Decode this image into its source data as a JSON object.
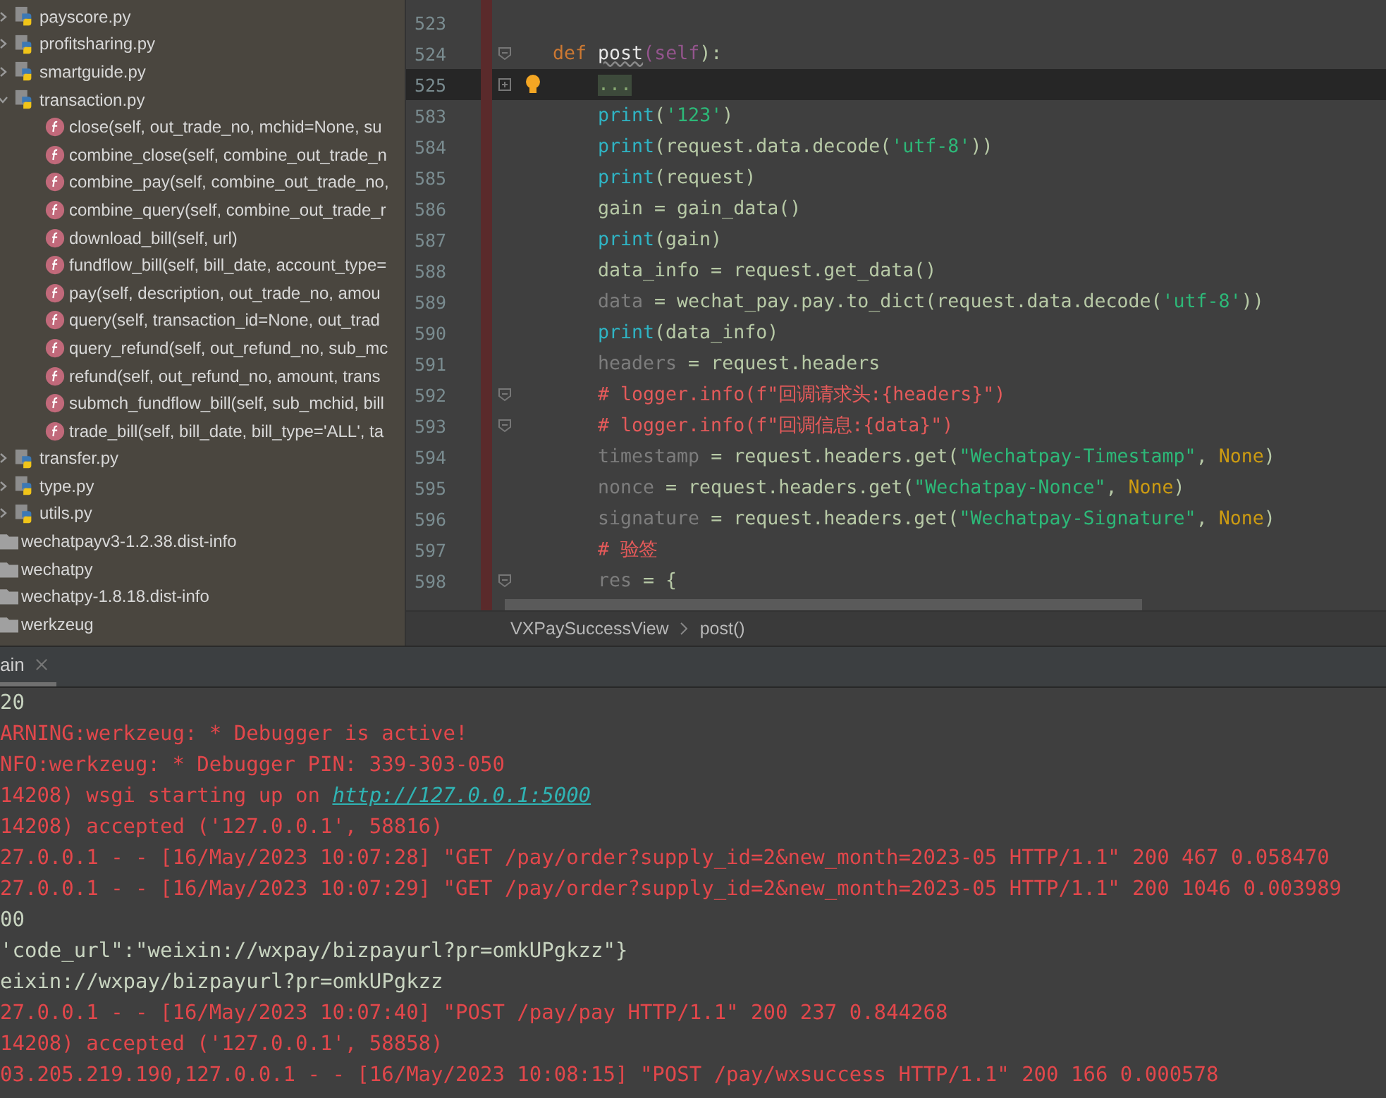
{
  "project_tree": [
    {
      "kind": "file",
      "label": "payscore.py",
      "expanded": false
    },
    {
      "kind": "file",
      "label": "profitsharing.py",
      "expanded": false
    },
    {
      "kind": "file",
      "label": "smartguide.py",
      "expanded": false
    },
    {
      "kind": "file",
      "label": "transaction.py",
      "expanded": true,
      "children": [
        {
          "kind": "func",
          "label": "close(self, out_trade_no, mchid=None, su"
        },
        {
          "kind": "func",
          "label": "combine_close(self, combine_out_trade_n"
        },
        {
          "kind": "func",
          "label": "combine_pay(self, combine_out_trade_no,"
        },
        {
          "kind": "func",
          "label": "combine_query(self, combine_out_trade_r"
        },
        {
          "kind": "func",
          "label": "download_bill(self, url)"
        },
        {
          "kind": "func",
          "label": "fundflow_bill(self, bill_date, account_type="
        },
        {
          "kind": "func",
          "label": "pay(self, description, out_trade_no, amou"
        },
        {
          "kind": "func",
          "label": "query(self, transaction_id=None, out_trad"
        },
        {
          "kind": "func",
          "label": "query_refund(self, out_refund_no, sub_mc"
        },
        {
          "kind": "func",
          "label": "refund(self, out_refund_no, amount, trans"
        },
        {
          "kind": "func",
          "label": "submch_fundflow_bill(self, sub_mchid, bill"
        },
        {
          "kind": "func",
          "label": "trade_bill(self, bill_date, bill_type='ALL', ta"
        }
      ]
    },
    {
      "kind": "file",
      "label": "transfer.py",
      "expanded": false
    },
    {
      "kind": "file",
      "label": "type.py",
      "expanded": false
    },
    {
      "kind": "file",
      "label": "utils.py",
      "expanded": false
    },
    {
      "kind": "folder",
      "label": "wechatpayv3-1.2.38.dist-info"
    },
    {
      "kind": "folder",
      "label": "wechatpy"
    },
    {
      "kind": "folder",
      "label": "wechatpy-1.8.18.dist-info"
    },
    {
      "kind": "folder",
      "label": "werkzeug"
    }
  ],
  "editor": {
    "lines": [
      {
        "number": "523",
        "selected": false
      },
      {
        "number": "524",
        "selected": false,
        "collapsed": false,
        "segments": [
          {
            "kind": "kw",
            "text": "def "
          },
          {
            "kind": "name",
            "text": "post"
          },
          {
            "kind": "param",
            "text": "(self"
          },
          {
            "kind": "plain",
            "text": "):"
          }
        ],
        "children": [
          {
            "number": "525",
            "selected": true,
            "collapsed": true,
            "hint": true,
            "segments": [
              {
                "kind": "folded",
                "text": "..."
              }
            ]
          },
          {
            "number": "583",
            "selected": false,
            "segments": [
              {
                "kind": "builtin",
                "text": "print"
              },
              {
                "kind": "plain",
                "text": "("
              },
              {
                "kind": "str",
                "text": "'123'"
              },
              {
                "kind": "plain",
                "text": ")"
              }
            ]
          },
          {
            "number": "584",
            "selected": false,
            "segments": [
              {
                "kind": "builtin",
                "text": "print"
              },
              {
                "kind": "plain",
                "text": "(request.data.decode("
              },
              {
                "kind": "str",
                "text": "'utf-8'"
              },
              {
                "kind": "plain",
                "text": "))"
              }
            ]
          },
          {
            "number": "585",
            "selected": false,
            "segments": [
              {
                "kind": "builtin",
                "text": "print"
              },
              {
                "kind": "plain",
                "text": "(request)"
              }
            ]
          },
          {
            "number": "586",
            "selected": false,
            "segments": [
              {
                "kind": "plain",
                "text": "gain = gain_data()"
              }
            ]
          },
          {
            "number": "587",
            "selected": false,
            "segments": [
              {
                "kind": "builtin",
                "text": "print"
              },
              {
                "kind": "plain",
                "text": "(gain)"
              }
            ]
          },
          {
            "number": "588",
            "selected": false,
            "segments": [
              {
                "kind": "plain",
                "text": "data_info = request.get_data()"
              }
            ]
          },
          {
            "number": "589",
            "selected": false,
            "segments": [
              {
                "kind": "unused",
                "text": "data"
              },
              {
                "kind": "plain",
                "text": " = wechat_pay.pay.to_dict(request.data.decode("
              },
              {
                "kind": "str",
                "text": "'utf-8'"
              },
              {
                "kind": "plain",
                "text": "))"
              }
            ]
          },
          {
            "number": "590",
            "selected": false,
            "segments": [
              {
                "kind": "builtin",
                "text": "print"
              },
              {
                "kind": "plain",
                "text": "(data_info)"
              }
            ]
          },
          {
            "number": "591",
            "selected": false,
            "segments": [
              {
                "kind": "unused",
                "text": "headers"
              },
              {
                "kind": "plain",
                "text": " = request.headers"
              }
            ]
          },
          {
            "number": "592",
            "selected": false,
            "collapsed": false,
            "segments": [
              {
                "kind": "comment",
                "text": "# logger.info(f\"回调请求头:{headers}\")"
              }
            ]
          },
          {
            "number": "593",
            "selected": false,
            "collapsed": false,
            "segments": [
              {
                "kind": "comment",
                "text": "# logger.info(f\"回调信息:{data}\")"
              }
            ]
          },
          {
            "number": "594",
            "selected": false,
            "segments": [
              {
                "kind": "unused",
                "text": "timestamp"
              },
              {
                "kind": "plain",
                "text": " = request.headers.get("
              },
              {
                "kind": "str",
                "text": "\"Wechatpay-Timestamp\""
              },
              {
                "kind": "plain",
                "text": ", "
              },
              {
                "kind": "const",
                "text": "None"
              },
              {
                "kind": "plain",
                "text": ")"
              }
            ]
          },
          {
            "number": "595",
            "selected": false,
            "segments": [
              {
                "kind": "unused",
                "text": "nonce"
              },
              {
                "kind": "plain",
                "text": " = request.headers.get("
              },
              {
                "kind": "str",
                "text": "\"Wechatpay-Nonce\""
              },
              {
                "kind": "plain",
                "text": ", "
              },
              {
                "kind": "const",
                "text": "None"
              },
              {
                "kind": "plain",
                "text": ")"
              }
            ]
          },
          {
            "number": "596",
            "selected": false,
            "segments": [
              {
                "kind": "unused",
                "text": "signature"
              },
              {
                "kind": "plain",
                "text": " = request.headers.get("
              },
              {
                "kind": "str",
                "text": "\"Wechatpay-Signature\""
              },
              {
                "kind": "plain",
                "text": ", "
              },
              {
                "kind": "const",
                "text": "None"
              },
              {
                "kind": "plain",
                "text": ")"
              }
            ]
          },
          {
            "number": "597",
            "selected": false,
            "segments": [
              {
                "kind": "comment",
                "text": "# 验签"
              }
            ]
          },
          {
            "number": "598",
            "selected": false,
            "collapsed": false,
            "segments": [
              {
                "kind": "unused",
                "text": "res"
              },
              {
                "kind": "plain",
                "text": " = {"
              }
            ]
          }
        ]
      }
    ],
    "breadcrumbs": [
      "VXPaySuccessView",
      "post()"
    ]
  },
  "run_panel": {
    "tab": "ain",
    "lines": [
      {
        "kind": "out",
        "text": "20"
      },
      {
        "kind": "err",
        "text": "ARNING:werkzeug: * Debugger is active!"
      },
      {
        "kind": "err",
        "text": "NFO:werkzeug: * Debugger PIN: 339-303-050"
      },
      {
        "kind": "err",
        "text": "14208) wsgi starting up on ",
        "link": "http://127.0.0.1:5000"
      },
      {
        "kind": "err",
        "text": "14208) accepted ('127.0.0.1', 58816)"
      },
      {
        "kind": "err",
        "text": "27.0.0.1 - - [16/May/2023 10:07:28] \"GET /pay/order?supply_id=2&new_month=2023-05 HTTP/1.1\" 200 467 0.058470"
      },
      {
        "kind": "err",
        "text": "27.0.0.1 - - [16/May/2023 10:07:29] \"GET /pay/order?supply_id=2&new_month=2023-05 HTTP/1.1\" 200 1046 0.003989"
      },
      {
        "kind": "out",
        "text": "00"
      },
      {
        "kind": "out",
        "text": "'code_url\":\"weixin://wxpay/bizpayurl?pr=omkUPgkzz\"}"
      },
      {
        "kind": "out",
        "text": "eixin://wxpay/bizpayurl?pr=omkUPgkzz"
      },
      {
        "kind": "err",
        "text": "27.0.0.1 - - [16/May/2023 10:07:40] \"POST /pay/pay HTTP/1.1\" 200 237 0.844268"
      },
      {
        "kind": "err",
        "text": "14208) accepted ('127.0.0.1', 58858)"
      },
      {
        "kind": "err",
        "text": "03.205.219.190,127.0.0.1 - - [16/May/2023 10:08:15] \"POST /pay/wxsuccess HTTP/1.1\" 200 166 0.000578"
      }
    ]
  }
}
